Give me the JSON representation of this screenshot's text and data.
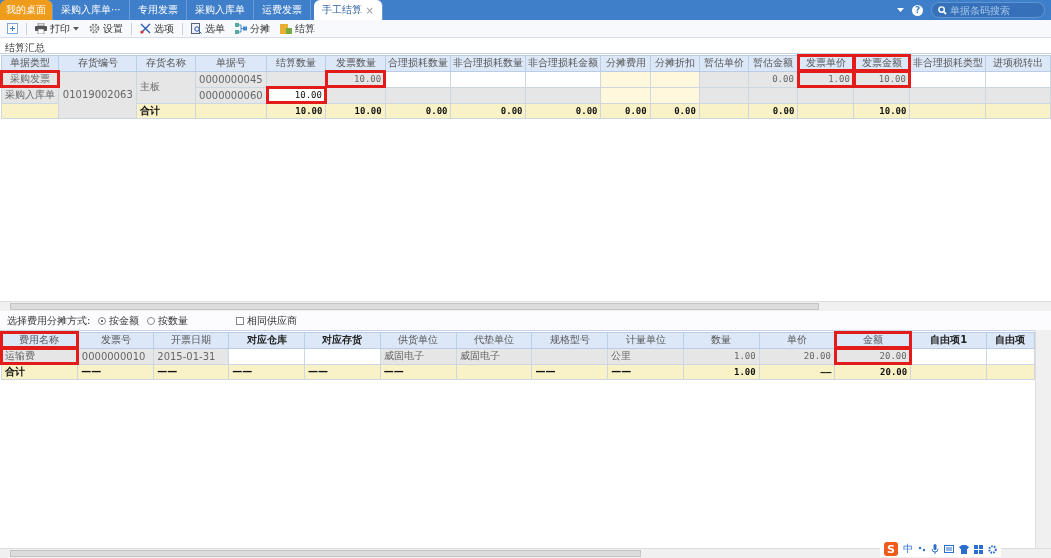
{
  "tabs": [
    {
      "label": "我的桌面",
      "kind": "home",
      "selected": false
    },
    {
      "label": "采购入库单···",
      "kind": "doc",
      "selected": false
    },
    {
      "label": "专用发票",
      "kind": "doc",
      "selected": false
    },
    {
      "label": "采购入库单",
      "kind": "doc",
      "selected": false
    },
    {
      "label": "运费发票",
      "kind": "doc",
      "selected": false
    },
    {
      "label": "手工结算",
      "kind": "doc",
      "selected": true,
      "close": "×"
    }
  ],
  "header_tools": {
    "help": "?",
    "search": {
      "placeholder": "单据条码搜索"
    }
  },
  "toolbar": [
    {
      "kind": "add"
    },
    {
      "kind": "print",
      "label": "打印"
    },
    {
      "kind": "settings",
      "label": "设置"
    },
    {
      "kind": "options",
      "label": "选项"
    },
    {
      "kind": "select",
      "label": "选单"
    },
    {
      "kind": "share",
      "label": "分摊"
    },
    {
      "kind": "settle",
      "label": "结算"
    }
  ],
  "summary": {
    "title": "结算汇总",
    "columns": [
      {
        "label": "单据类型",
        "kind": "label",
        "highlighted": false
      },
      {
        "label": "存货编号",
        "kind": "text",
        "highlighted": false
      },
      {
        "label": "存货名称",
        "kind": "text",
        "highlighted": false
      },
      {
        "label": "单据号",
        "kind": "text",
        "highlighted": false
      },
      {
        "label": "结算数量",
        "kind": "number",
        "highlighted": false
      },
      {
        "label": "发票数量",
        "kind": "number",
        "highlighted": false
      },
      {
        "label": "合理损耗数量",
        "kind": "number",
        "highlighted": false
      },
      {
        "label": "非合理损耗数量",
        "kind": "number",
        "highlighted": false
      },
      {
        "label": "非合理损耗金额",
        "kind": "number",
        "highlighted": false
      },
      {
        "label": "分摊费用",
        "kind": "number",
        "highlighted": false
      },
      {
        "label": "分摊折扣",
        "kind": "number",
        "highlighted": false
      },
      {
        "label": "暂估单价",
        "kind": "number",
        "highlighted": false
      },
      {
        "label": "暂估金额",
        "kind": "number",
        "highlighted": false
      },
      {
        "label": "发票单价",
        "kind": "number",
        "highlighted": true
      },
      {
        "label": "发票金额",
        "kind": "number",
        "highlighted": true
      },
      {
        "label": "非合理损耗类型",
        "kind": "text",
        "highlighted": false
      },
      {
        "label": "进项税转出",
        "kind": "text",
        "highlighted": false
      }
    ],
    "rows": [
      {
        "kind": "data",
        "cells": [
          {
            "text": "采购发票",
            "kind": "readonly",
            "highlighted": true
          },
          {
            "text": "01019002063",
            "kind": "readonly",
            "rowspan": 3,
            "highlighted": false
          },
          {
            "text": "主板",
            "kind": "readonly",
            "rowspan": 2,
            "highlighted": false
          },
          {
            "text": "0000000045",
            "kind": "readonly",
            "highlighted": false
          },
          {
            "kind": "readonly",
            "highlighted": false
          },
          {
            "text": "10.00",
            "kind": "readonly",
            "highlighted": true
          },
          {
            "kind": "editable",
            "highlighted": false
          },
          {
            "kind": "editable",
            "highlighted": false
          },
          {
            "kind": "editable",
            "highlighted": false
          },
          {
            "kind": "share",
            "highlighted": false
          },
          {
            "kind": "share",
            "highlighted": false
          },
          {
            "kind": "readonly",
            "highlighted": false
          },
          {
            "text": "0.00",
            "kind": "readonly",
            "highlighted": false
          },
          {
            "text": "1.00",
            "kind": "readonly",
            "highlighted": true
          },
          {
            "text": "10.00",
            "kind": "readonly",
            "highlighted": true
          },
          {
            "kind": "editable",
            "highlighted": false
          },
          {
            "kind": "editable",
            "highlighted": false
          }
        ]
      },
      {
        "kind": "data",
        "cells": [
          {
            "text": "采购入库单",
            "kind": "readonly",
            "highlighted": false
          },
          {
            "text": "0000000060",
            "kind": "readonly",
            "highlighted": false
          },
          {
            "text": "10.00",
            "kind": "editable",
            "highlighted": true
          },
          {
            "kind": "readonly",
            "highlighted": false
          },
          {
            "kind": "readonly",
            "highlighted": false
          },
          {
            "kind": "readonly",
            "highlighted": false
          },
          {
            "kind": "readonly",
            "highlighted": false
          },
          {
            "kind": "share",
            "highlighted": false
          },
          {
            "kind": "share",
            "highlighted": false
          },
          {
            "kind": "readonly",
            "highlighted": false
          },
          {
            "kind": "readonly",
            "highlighted": false
          },
          {
            "kind": "readonly",
            "highlighted": false
          },
          {
            "kind": "readonly",
            "highlighted": false
          },
          {
            "kind": "readonly",
            "highlighted": false
          },
          {
            "kind": "readonly",
            "highlighted": false
          }
        ]
      },
      {
        "kind": "total",
        "cells": [
          {
            "highlighted": false
          },
          {
            "text": "合计",
            "highlighted": false
          },
          {
            "highlighted": false
          },
          {
            "text": "10.00",
            "highlighted": false
          },
          {
            "text": "10.00",
            "highlighted": false
          },
          {
            "text": "0.00",
            "highlighted": false
          },
          {
            "text": "0.00",
            "highlighted": false
          },
          {
            "text": "0.00",
            "highlighted": false
          },
          {
            "text": "0.00",
            "highlighted": false
          },
          {
            "text": "0.00",
            "highlighted": false
          },
          {
            "highlighted": false
          },
          {
            "text": "0.00",
            "highlighted": false
          },
          {
            "highlighted": false
          },
          {
            "text": "10.00",
            "highlighted": false
          },
          {
            "highlighted": false
          },
          {
            "highlighted": false
          }
        ]
      }
    ]
  },
  "allocation": {
    "label": "选择费用分摊方式:",
    "options": [
      {
        "label": "按金额",
        "selected": true
      },
      {
        "label": "按数量",
        "selected": false
      }
    ],
    "same_supplier": {
      "label": "相同供应商",
      "checked": false
    }
  },
  "fees": {
    "columns": [
      {
        "label": "费用名称",
        "kind": "text",
        "bold": false,
        "highlighted": true
      },
      {
        "label": "发票号",
        "kind": "text",
        "bold": false,
        "highlighted": false
      },
      {
        "label": "开票日期",
        "kind": "text",
        "bold": false,
        "highlighted": false
      },
      {
        "label": "对应仓库",
        "kind": "text",
        "bold": true,
        "highlighted": false
      },
      {
        "label": "对应存货",
        "kind": "text",
        "bold": true,
        "highlighted": false
      },
      {
        "label": "供货单位",
        "kind": "text",
        "bold": false,
        "highlighted": false
      },
      {
        "label": "代垫单位",
        "kind": "text",
        "bold": false,
        "highlighted": false
      },
      {
        "label": "规格型号",
        "kind": "text",
        "bold": false,
        "highlighted": false
      },
      {
        "label": "计量单位",
        "kind": "text",
        "bold": false,
        "highlighted": false
      },
      {
        "label": "数量",
        "kind": "number",
        "bold": false,
        "highlighted": false
      },
      {
        "label": "单价",
        "kind": "number",
        "bold": false,
        "highlighted": false
      },
      {
        "label": "金额",
        "kind": "number",
        "bold": false,
        "highlighted": true
      },
      {
        "label": "自由项1",
        "kind": "text",
        "bold": true,
        "highlighted": false
      },
      {
        "label": "自由项",
        "kind": "text",
        "bold": true,
        "highlighted": false
      }
    ],
    "rows": [
      {
        "kind": "data",
        "cells": [
          {
            "text": "运输费",
            "kind": "readonly",
            "highlighted": true
          },
          {
            "text": "0000000010",
            "kind": "readonly",
            "highlighted": false
          },
          {
            "text": "2015-01-31",
            "kind": "readonly",
            "highlighted": false
          },
          {
            "kind": "editable",
            "highlighted": false
          },
          {
            "kind": "editable",
            "highlighted": false
          },
          {
            "text": "威固电子",
            "kind": "readonly",
            "highlighted": false
          },
          {
            "text": "威固电子",
            "kind": "readonly",
            "highlighted": false
          },
          {
            "kind": "readonly",
            "highlighted": false
          },
          {
            "text": "公里",
            "kind": "readonly",
            "highlighted": false
          },
          {
            "text": "1.00",
            "kind": "readonly",
            "highlighted": false
          },
          {
            "text": "20.00",
            "kind": "readonly",
            "highlighted": false
          },
          {
            "text": "20.00",
            "kind": "readonly",
            "highlighted": true
          },
          {
            "kind": "editable",
            "highlighted": false
          },
          {
            "kind": "editable",
            "highlighted": false
          }
        ]
      },
      {
        "kind": "total",
        "cells": [
          {
            "text": "合计",
            "highlighted": false
          },
          {
            "text": "——",
            "highlighted": false
          },
          {
            "text": "——",
            "highlighted": false
          },
          {
            "text": "——",
            "highlighted": false
          },
          {
            "text": "——",
            "highlighted": false
          },
          {
            "text": "——",
            "highlighted": false
          },
          {
            "highlighted": false
          },
          {
            "text": "——",
            "highlighted": false
          },
          {
            "text": "——",
            "highlighted": false
          },
          {
            "text": "1.00",
            "highlighted": false
          },
          {
            "text": "——",
            "highlighted": false
          },
          {
            "text": "20.00",
            "highlighted": false
          },
          {
            "highlighted": false
          },
          {
            "highlighted": false
          }
        ]
      }
    ]
  },
  "ime_bar": {
    "logo": "S",
    "mode": "中"
  }
}
